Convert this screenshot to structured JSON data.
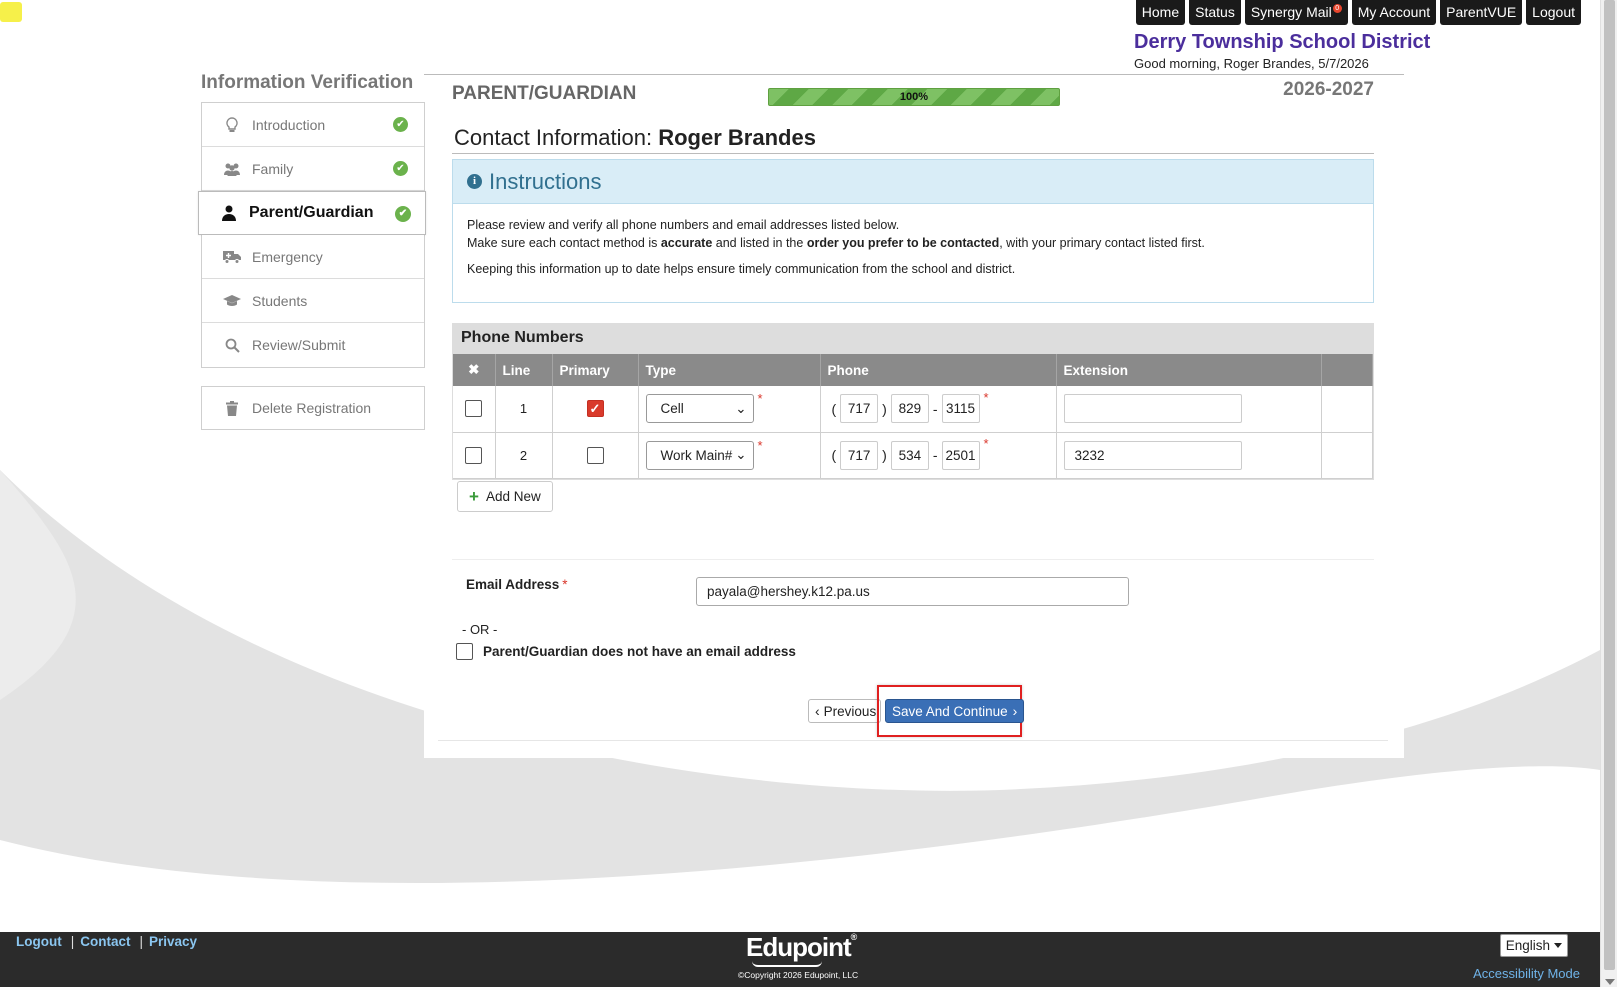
{
  "topnav": {
    "home": "Home",
    "status": "Status",
    "synergy_mail": "Synergy Mail",
    "mail_badge": "0",
    "my_account": "My Account",
    "parentvue": "ParentVUE",
    "logout": "Logout"
  },
  "header": {
    "district": "Derry Township School District",
    "greeting": "Good morning, Roger Brandes, 5/7/2026"
  },
  "sidebar": {
    "title": "Information Verification",
    "items": [
      {
        "label": "Introduction",
        "icon": "lightbulb-icon",
        "done": true
      },
      {
        "label": "Family",
        "icon": "users-icon",
        "done": true
      },
      {
        "label": "Parent/Guardian",
        "icon": "user-icon",
        "done": true,
        "active": true
      },
      {
        "label": "Emergency",
        "icon": "ambulance-icon",
        "done": false
      },
      {
        "label": "Students",
        "icon": "graduation-cap-icon",
        "done": false
      },
      {
        "label": "Review/Submit",
        "icon": "search-icon",
        "done": false
      }
    ],
    "delete_label": "Delete Registration"
  },
  "main": {
    "section_title": "PARENT/GUARDIAN",
    "progress_text": "100%",
    "progress_value": 100,
    "year": "2026-2027",
    "contact_prefix": "Contact Information:",
    "contact_name": "Roger Brandes"
  },
  "instructions": {
    "title": "Instructions",
    "line1": "Please review and verify all phone numbers and email addresses listed below.",
    "line2_a": "Make sure each contact method is ",
    "line2_b": "accurate",
    "line2_c": " and listed in the ",
    "line2_d": "order you prefer to be contacted",
    "line2_e": ", with your primary contact listed first.",
    "line3": "Keeping this information up to date helps ensure timely communication from the school and district."
  },
  "phones": {
    "title": "Phone Numbers",
    "headers": {
      "delete": "✖",
      "line": "Line",
      "primary": "Primary",
      "type": "Type",
      "phone": "Phone",
      "extension": "Extension"
    },
    "rows": [
      {
        "line": "1",
        "primary": true,
        "type": "Cell",
        "area": "717",
        "prefix": "829",
        "number": "3115",
        "extension": ""
      },
      {
        "line": "2",
        "primary": false,
        "type": "Work Main#",
        "area": "717",
        "prefix": "534",
        "number": "2501",
        "extension": "3232"
      }
    ],
    "open_paren": "(",
    "close_paren": ")",
    "dash": "-",
    "required_mark": "*",
    "add_new": "Add New"
  },
  "email": {
    "label": "Email Address",
    "required_mark": "*",
    "value": "payala@hershey.k12.pa.us",
    "or_text": "- OR -",
    "no_email_label": "Parent/Guardian does not have an email address"
  },
  "buttons": {
    "previous": "Previous",
    "save_continue": "Save And Continue"
  },
  "footer": {
    "logout": "Logout",
    "contact": "Contact",
    "privacy": "Privacy",
    "pipe": "|",
    "logo": "Edupoint",
    "trademark": "®",
    "copyright": "©Copyright 2026 Edupoint, LLC",
    "language": "English",
    "accessibility": "Accessibility Mode"
  },
  "colors": {
    "district": "#4b2e9c",
    "check": "#6bb24c",
    "save_button": "#3a6fb6",
    "highlight": "#e02020",
    "instructions_bg": "#d9edf7"
  }
}
